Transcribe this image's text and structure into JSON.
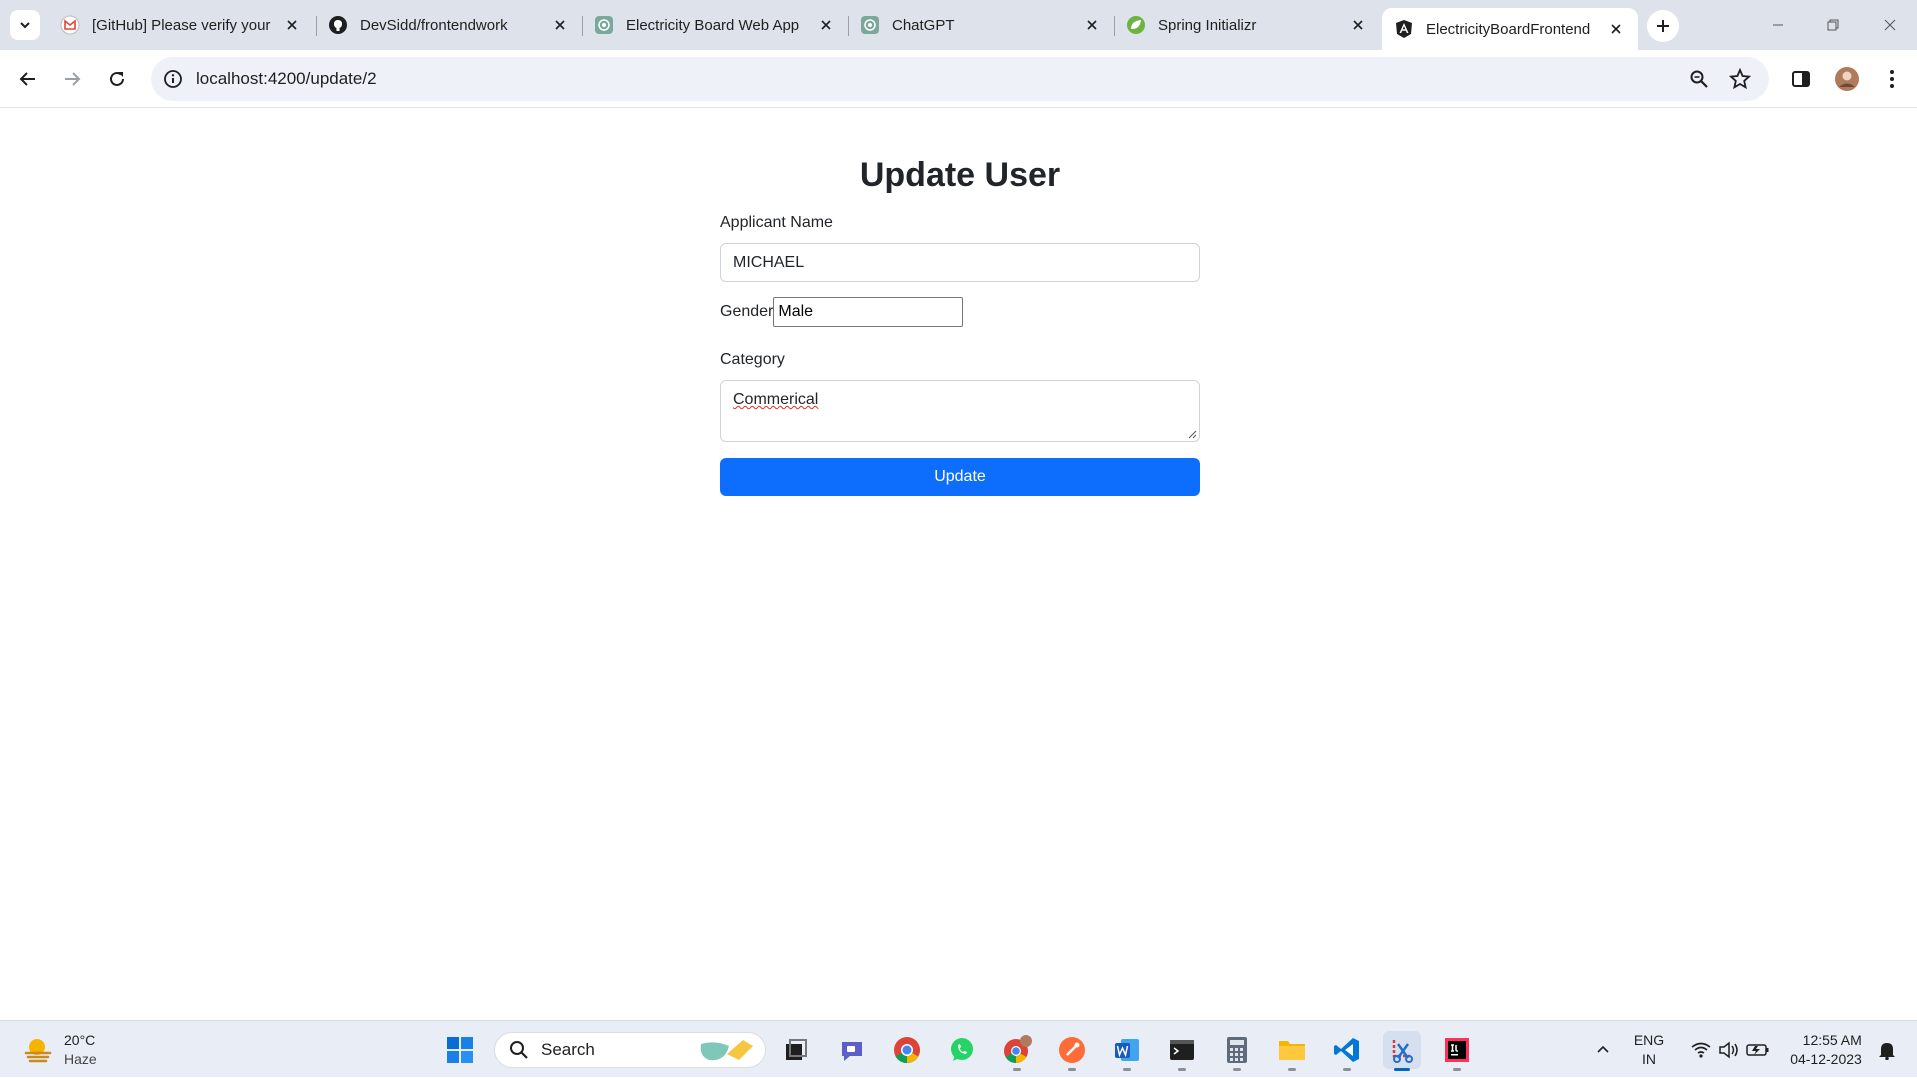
{
  "browser": {
    "tabs": [
      {
        "title": "[GitHub] Please verify your",
        "icon": "gmail-icon",
        "active": false
      },
      {
        "title": "DevSidd/frontendwork",
        "icon": "github-icon",
        "active": false
      },
      {
        "title": "Electricity Board Web App",
        "icon": "openai-icon",
        "active": false
      },
      {
        "title": "ChatGPT",
        "icon": "openai-icon",
        "active": false
      },
      {
        "title": "Spring Initializr",
        "icon": "spring-icon",
        "active": false
      },
      {
        "title": "ElectricityBoardFrontend",
        "icon": "angular-icon",
        "active": true
      }
    ],
    "url": "localhost:4200/update/2"
  },
  "form": {
    "title": "Update User",
    "name_label": "Applicant Name",
    "name_value": "MICHAEL",
    "gender_label": "Gender",
    "gender_value": "Male",
    "category_label": "Category",
    "category_value": "Commerical",
    "submit_label": "Update"
  },
  "taskbar": {
    "weather": {
      "temp": "20°C",
      "condition": "Haze"
    },
    "search_placeholder": "Search",
    "language": {
      "line1": "ENG",
      "line2": "IN"
    },
    "clock": {
      "time": "12:55 AM",
      "date": "04-12-2023"
    }
  },
  "colors": {
    "primary_button": "#0d6efd",
    "tabstrip_bg": "#dee3eb",
    "omnibox_bg": "#eef1f8",
    "taskbar_bg": "#e9eef6"
  }
}
